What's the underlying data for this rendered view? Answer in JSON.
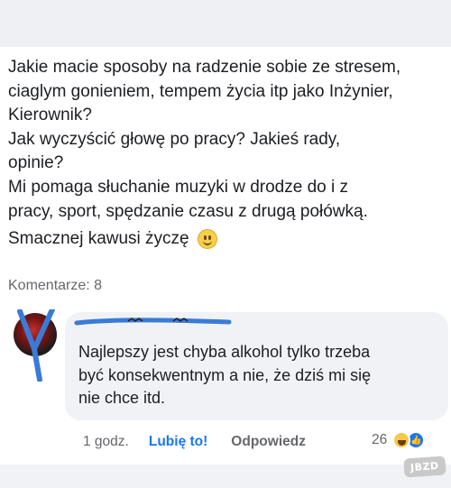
{
  "post": {
    "lines": [
      "Jakie macie sposoby na radzenie sobie ze stresem,",
      "ciaglym gonieniem, tempem życia itp jako Inżynier,",
      "Kierownik?",
      "Jak wyczyścić głowę po pracy? Jakieś rady,",
      "opinie?",
      "Mi pomaga słuchanie muzyki w drodze do i z",
      "pracy, sport, spędzanie czasu z drugą połówką."
    ],
    "greeting": "Smacznej kawusi życzę",
    "greeting_emoji": "slightly-smiling-face-icon",
    "comments_count": "Komentarze: 8"
  },
  "comment": {
    "author_redacted": true,
    "text_lines": [
      "Najlepszy jest chyba alkohol tylko trzeba",
      "być konsekwentnym a nie, że dziś mi się",
      "nie chce itd."
    ],
    "time": "1 godz.",
    "like_label": "Lubię to!",
    "reply_label": "Odpowiedz",
    "reaction_count": "26",
    "reactions": [
      "haha-icon",
      "like-icon"
    ]
  },
  "watermark": "JBZD",
  "colors": {
    "accent": "#1877f2",
    "bubble": "#f0f2f5",
    "scribble": "#3a7bd5",
    "muted": "#65676b"
  }
}
